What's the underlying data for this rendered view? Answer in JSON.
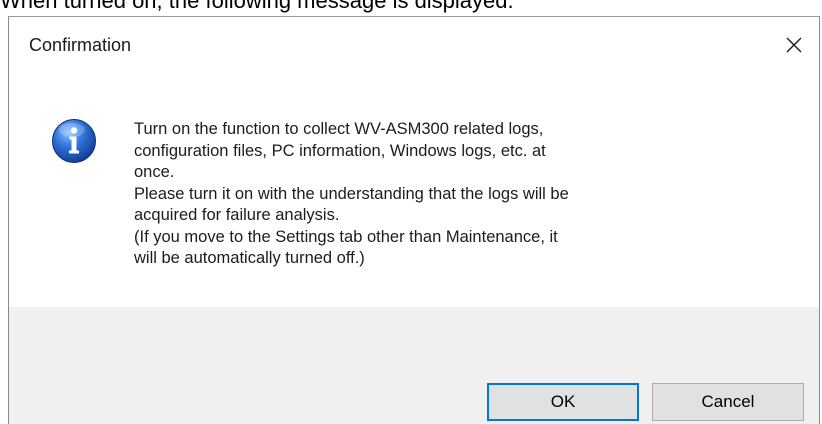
{
  "caption": "When turned on, the following message is displayed.",
  "dialog": {
    "title": "Confirmation",
    "close_glyph": "✕",
    "icon": "info-icon",
    "message_lines": [
      "Turn on the function to collect WV-ASM300 related logs,",
      "configuration files, PC information, Windows logs, etc. at",
      "once.",
      "Please turn it on with the understanding that the logs will be",
      "acquired for failure analysis.",
      "(If you move to the Settings tab other than Maintenance, it",
      "will be automatically turned off.)"
    ],
    "buttons": {
      "ok_label": "OK",
      "cancel_label": "Cancel"
    }
  },
  "colors": {
    "accent": "#0078d7",
    "footer_bg": "#f0f0f0",
    "icon_blue": "#1a5ab8"
  }
}
